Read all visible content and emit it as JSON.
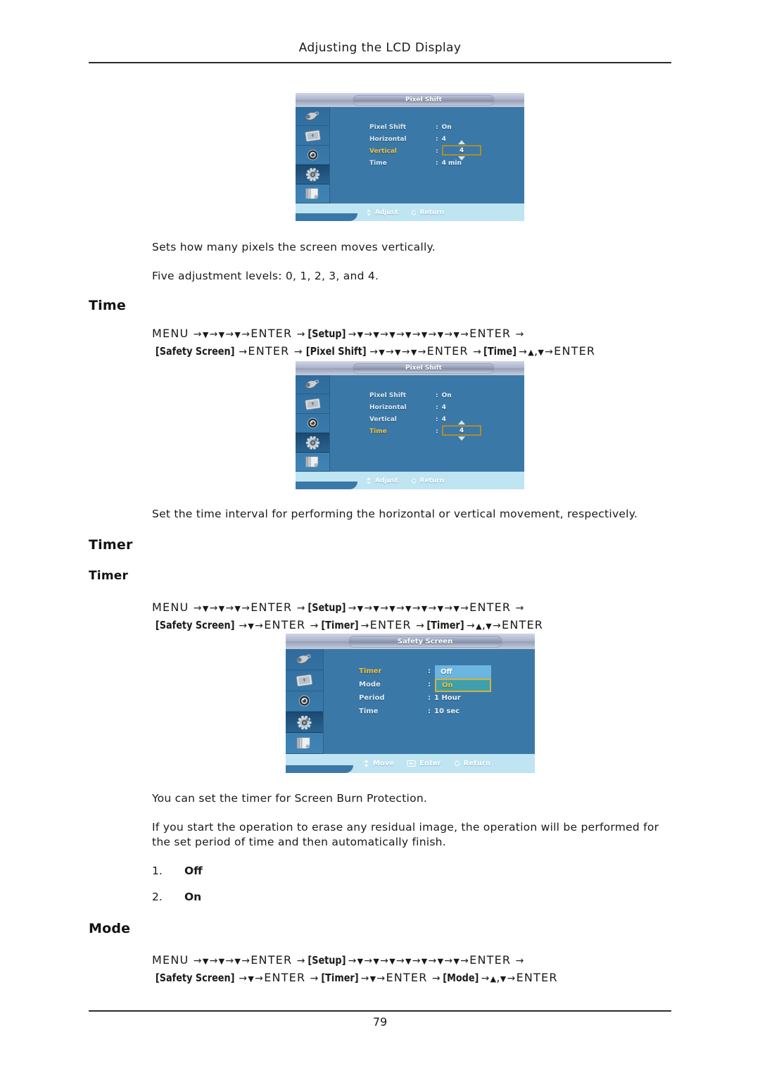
{
  "header": {
    "title": "Adjusting the LCD Display"
  },
  "footer": {
    "page_number": "79"
  },
  "colors": {
    "osd_body": "#3a78a8",
    "osd_highlight_text": "#f0c03a",
    "osd_status_bar": "#bfe4f2",
    "dropdown_option1": "#6bb5e2",
    "dropdown_option2": "#3fa0ad",
    "spinbox_border": "#b08b2c"
  },
  "osd_pixel_shift_vertical": {
    "title": "Pixel Shift",
    "sidebar_icons": [
      "input-source-icon",
      "picture-icon",
      "sound-icon",
      "setup-gear-icon",
      "multi-control-icon"
    ],
    "selected_sidebar_index": 3,
    "rows": [
      {
        "label": "Pixel Shift",
        "colon": ":",
        "value": "On",
        "highlighted": false
      },
      {
        "label": "Horizontal",
        "colon": ":",
        "value": "4",
        "highlighted": false
      },
      {
        "label": "Vertical",
        "colon": ":",
        "value": "4",
        "highlighted": true,
        "editing": true
      },
      {
        "label": "Time",
        "colon": ":",
        "value": "4 min",
        "highlighted": false
      }
    ],
    "status": [
      {
        "icon": "up-down-arrow-icon",
        "label": "Adjust"
      },
      {
        "icon": "return-icon",
        "label": "Return"
      }
    ]
  },
  "osd_pixel_shift_time": {
    "title": "Pixel Shift",
    "sidebar_icons": [
      "input-source-icon",
      "picture-icon",
      "sound-icon",
      "setup-gear-icon",
      "multi-control-icon"
    ],
    "selected_sidebar_index": 3,
    "rows": [
      {
        "label": "Pixel Shift",
        "colon": ":",
        "value": "On",
        "highlighted": false
      },
      {
        "label": "Horizontal",
        "colon": ":",
        "value": "4",
        "highlighted": false
      },
      {
        "label": "Vertical",
        "colon": ":",
        "value": "4",
        "highlighted": false
      },
      {
        "label": "Time",
        "colon": ":",
        "value": "4",
        "highlighted": true,
        "editing": true
      }
    ],
    "status": [
      {
        "icon": "up-down-arrow-icon",
        "label": "Adjust"
      },
      {
        "icon": "return-icon",
        "label": "Return"
      }
    ]
  },
  "osd_safety_screen": {
    "title": "Safety Screen",
    "sidebar_icons": [
      "input-source-icon",
      "picture-icon",
      "sound-icon",
      "setup-gear-icon",
      "multi-control-icon"
    ],
    "selected_sidebar_index": 3,
    "rows": [
      {
        "label": "Timer",
        "colon": ":",
        "value": "",
        "highlighted": true
      },
      {
        "label": "Mode",
        "colon": ":",
        "value": "",
        "highlighted": false
      },
      {
        "label": "Period",
        "colon": ":",
        "value": "1 Hour",
        "highlighted": false
      },
      {
        "label": "Time",
        "colon": ":",
        "value": "10 sec",
        "highlighted": false
      }
    ],
    "dropdown": {
      "options": [
        "Off",
        "On"
      ],
      "selected_index": 1
    },
    "status": [
      {
        "icon": "up-down-arrow-icon",
        "label": "Move"
      },
      {
        "icon": "enter-icon",
        "label": "Enter"
      },
      {
        "icon": "return-icon",
        "label": "Return"
      }
    ]
  },
  "caption_vertical_1": "Sets how many pixels the screen moves vertically.",
  "caption_vertical_2": "Five adjustment levels: 0, 1, 2, 3, and 4.",
  "section_time": {
    "heading": "Time"
  },
  "caption_time": "Set the time interval for performing the horizontal or vertical movement, respectively.",
  "section_timer": {
    "heading": "Timer",
    "subheading": "Timer"
  },
  "caption_timer_1": "You can set the timer for Screen Burn Protection.",
  "caption_timer_2": "If you start the operation to erase any residual image, the operation will be performed for the set period of time and then automatically finish.",
  "timer_options": [
    {
      "num": "1.",
      "label": "Off"
    },
    {
      "num": "2.",
      "label": "On"
    }
  ],
  "section_mode": {
    "heading": "Mode"
  },
  "paths": {
    "time": {
      "line1": [
        {
          "t": "kw",
          "v": "MENU"
        },
        {
          "t": "ar",
          "v": "→"
        },
        {
          "t": "dn",
          "v": "▼"
        },
        {
          "t": "ar",
          "v": "→"
        },
        {
          "t": "dn",
          "v": "▼"
        },
        {
          "t": "ar",
          "v": "→"
        },
        {
          "t": "dn",
          "v": "▼"
        },
        {
          "t": "ar",
          "v": "→"
        },
        {
          "t": "kw",
          "v": "ENTER"
        },
        {
          "t": "ar",
          "v": "→"
        },
        {
          "t": "br",
          "v": "[Setup]"
        },
        {
          "t": "ar",
          "v": "→"
        },
        {
          "t": "dn",
          "v": "▼"
        },
        {
          "t": "ar",
          "v": "→"
        },
        {
          "t": "dn",
          "v": "▼"
        },
        {
          "t": "ar",
          "v": "→"
        },
        {
          "t": "dn",
          "v": "▼"
        },
        {
          "t": "ar",
          "v": "→"
        },
        {
          "t": "dn",
          "v": "▼"
        },
        {
          "t": "ar",
          "v": "→"
        },
        {
          "t": "dn",
          "v": "▼"
        },
        {
          "t": "ar",
          "v": "→"
        },
        {
          "t": "dn",
          "v": "▼"
        },
        {
          "t": "ar",
          "v": "→"
        },
        {
          "t": "dn",
          "v": "▼"
        },
        {
          "t": "ar",
          "v": "→"
        },
        {
          "t": "kw",
          "v": "ENTER"
        },
        {
          "t": "ar",
          "v": "→"
        }
      ],
      "line2": [
        {
          "t": "br",
          "v": "[Safety Screen]"
        },
        {
          "t": "ar",
          "v": "→"
        },
        {
          "t": "kw",
          "v": "ENTER"
        },
        {
          "t": "ar",
          "v": "→"
        },
        {
          "t": "br",
          "v": "[Pixel Shift]"
        },
        {
          "t": "ar",
          "v": "→"
        },
        {
          "t": "dn",
          "v": "▼"
        },
        {
          "t": "ar",
          "v": "→"
        },
        {
          "t": "dn",
          "v": "▼"
        },
        {
          "t": "ar",
          "v": "→"
        },
        {
          "t": "dn",
          "v": "▼"
        },
        {
          "t": "ar",
          "v": "→"
        },
        {
          "t": "kw",
          "v": "ENTER"
        },
        {
          "t": "ar",
          "v": "→"
        },
        {
          "t": "br",
          "v": "[Time]"
        },
        {
          "t": "ar",
          "v": "→"
        },
        {
          "t": "up",
          "v": "▲"
        },
        {
          "t": "pl",
          "v": ","
        },
        {
          "t": "dn",
          "v": "▼"
        },
        {
          "t": "ar",
          "v": "→"
        },
        {
          "t": "kw",
          "v": "ENTER"
        }
      ]
    },
    "timer": {
      "line1": [
        {
          "t": "kw",
          "v": "MENU"
        },
        {
          "t": "ar",
          "v": "→"
        },
        {
          "t": "dn",
          "v": "▼"
        },
        {
          "t": "ar",
          "v": "→"
        },
        {
          "t": "dn",
          "v": "▼"
        },
        {
          "t": "ar",
          "v": "→"
        },
        {
          "t": "dn",
          "v": "▼"
        },
        {
          "t": "ar",
          "v": "→"
        },
        {
          "t": "kw",
          "v": "ENTER"
        },
        {
          "t": "ar",
          "v": "→"
        },
        {
          "t": "br",
          "v": "[Setup]"
        },
        {
          "t": "ar",
          "v": "→"
        },
        {
          "t": "dn",
          "v": "▼"
        },
        {
          "t": "ar",
          "v": "→"
        },
        {
          "t": "dn",
          "v": "▼"
        },
        {
          "t": "ar",
          "v": "→"
        },
        {
          "t": "dn",
          "v": "▼"
        },
        {
          "t": "ar",
          "v": "→"
        },
        {
          "t": "dn",
          "v": "▼"
        },
        {
          "t": "ar",
          "v": "→"
        },
        {
          "t": "dn",
          "v": "▼"
        },
        {
          "t": "ar",
          "v": "→"
        },
        {
          "t": "dn",
          "v": "▼"
        },
        {
          "t": "ar",
          "v": "→"
        },
        {
          "t": "dn",
          "v": "▼"
        },
        {
          "t": "ar",
          "v": "→"
        },
        {
          "t": "kw",
          "v": "ENTER"
        },
        {
          "t": "ar",
          "v": "→"
        }
      ],
      "line2": [
        {
          "t": "br",
          "v": "[Safety Screen]"
        },
        {
          "t": "ar",
          "v": "→"
        },
        {
          "t": "dn",
          "v": "▼"
        },
        {
          "t": "ar",
          "v": "→"
        },
        {
          "t": "kw",
          "v": "ENTER"
        },
        {
          "t": "ar",
          "v": "→"
        },
        {
          "t": "br",
          "v": "[Timer]"
        },
        {
          "t": "ar",
          "v": "→"
        },
        {
          "t": "kw",
          "v": "ENTER"
        },
        {
          "t": "ar",
          "v": "→"
        },
        {
          "t": "br",
          "v": "[Timer]"
        },
        {
          "t": "ar",
          "v": "→"
        },
        {
          "t": "up",
          "v": "▲"
        },
        {
          "t": "pl",
          "v": ","
        },
        {
          "t": "dn",
          "v": "▼"
        },
        {
          "t": "ar",
          "v": "→"
        },
        {
          "t": "kw",
          "v": "ENTER"
        }
      ]
    },
    "mode": {
      "line1": [
        {
          "t": "kw",
          "v": "MENU"
        },
        {
          "t": "ar",
          "v": "→"
        },
        {
          "t": "dn",
          "v": "▼"
        },
        {
          "t": "ar",
          "v": "→"
        },
        {
          "t": "dn",
          "v": "▼"
        },
        {
          "t": "ar",
          "v": "→"
        },
        {
          "t": "dn",
          "v": "▼"
        },
        {
          "t": "ar",
          "v": "→"
        },
        {
          "t": "kw",
          "v": "ENTER"
        },
        {
          "t": "ar",
          "v": "→"
        },
        {
          "t": "br",
          "v": "[Setup]"
        },
        {
          "t": "ar",
          "v": "→"
        },
        {
          "t": "dn",
          "v": "▼"
        },
        {
          "t": "ar",
          "v": "→"
        },
        {
          "t": "dn",
          "v": "▼"
        },
        {
          "t": "ar",
          "v": "→"
        },
        {
          "t": "dn",
          "v": "▼"
        },
        {
          "t": "ar",
          "v": "→"
        },
        {
          "t": "dn",
          "v": "▼"
        },
        {
          "t": "ar",
          "v": "→"
        },
        {
          "t": "dn",
          "v": "▼"
        },
        {
          "t": "ar",
          "v": "→"
        },
        {
          "t": "dn",
          "v": "▼"
        },
        {
          "t": "ar",
          "v": "→"
        },
        {
          "t": "dn",
          "v": "▼"
        },
        {
          "t": "ar",
          "v": "→"
        },
        {
          "t": "kw",
          "v": "ENTER"
        },
        {
          "t": "ar",
          "v": "→"
        }
      ],
      "line2": [
        {
          "t": "br",
          "v": "[Safety Screen]"
        },
        {
          "t": "ar",
          "v": "→"
        },
        {
          "t": "dn",
          "v": "▼"
        },
        {
          "t": "ar",
          "v": "→"
        },
        {
          "t": "kw",
          "v": "ENTER"
        },
        {
          "t": "ar",
          "v": "→"
        },
        {
          "t": "br",
          "v": "[Timer]"
        },
        {
          "t": "ar",
          "v": "→"
        },
        {
          "t": "dn",
          "v": "▼"
        },
        {
          "t": "ar",
          "v": "→"
        },
        {
          "t": "kw",
          "v": "ENTER"
        },
        {
          "t": "ar",
          "v": "→"
        },
        {
          "t": "br",
          "v": "[Mode]"
        },
        {
          "t": "ar",
          "v": "→"
        },
        {
          "t": "up",
          "v": "▲"
        },
        {
          "t": "pl",
          "v": ","
        },
        {
          "t": "dn",
          "v": "▼"
        },
        {
          "t": "ar",
          "v": "→"
        },
        {
          "t": "kw",
          "v": "ENTER"
        }
      ]
    }
  }
}
